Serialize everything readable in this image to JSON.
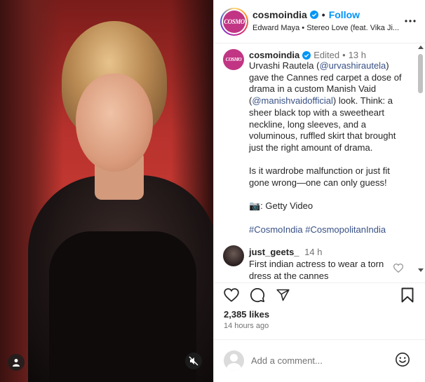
{
  "header": {
    "username": "cosmoindia",
    "follow_label": "Follow",
    "dot": "•",
    "audio": "Edward Maya • Stereo Love (feat. Vika Ji...",
    "avatar_text": "COSMO"
  },
  "caption": {
    "username": "cosmoindia",
    "edited": "Edited",
    "dot": "•",
    "age": "13 h",
    "avatar_text": "COSMO",
    "para1_a": "Urvashi Rautela (",
    "para1_link1": "@urvashirautela",
    "para1_b": ") gave the Cannes red carpet a dose of drama in a custom Manish Vaid (",
    "para1_link2": "@manishvaidofficial",
    "para1_c": ") look. Think: a sheer black top with a sweetheart neckline, long sleeves, and a voluminous, ruffled skirt that brought just the right amount of drama.",
    "para2": "Is it wardrobe malfunction or just fit gone wrong—one can only guess!",
    "para3": "📷: Getty Video",
    "hashtag1": "#CosmoIndia",
    "hashtag2": "#CosmopolitanIndia"
  },
  "comment": {
    "username": "just_geets_",
    "age": "14 h",
    "text": "First indian actress to wear a torn dress at the cannes"
  },
  "post": {
    "likes": "2,385 likes",
    "time": "14 hours ago"
  },
  "add_comment": {
    "placeholder": "Add a comment..."
  },
  "icons": {
    "like": "heart-icon",
    "comment": "comment-icon",
    "share": "share-icon",
    "save": "bookmark-icon",
    "more": "more-icon",
    "emoji": "emoji-icon",
    "mute": "muted-speaker-icon",
    "user_tag": "user-tag-icon",
    "verified": "verified-badge-icon"
  },
  "colors": {
    "accent": "#0095f6",
    "link": "#385185",
    "muted": "#737373",
    "brand": "#c13584"
  }
}
